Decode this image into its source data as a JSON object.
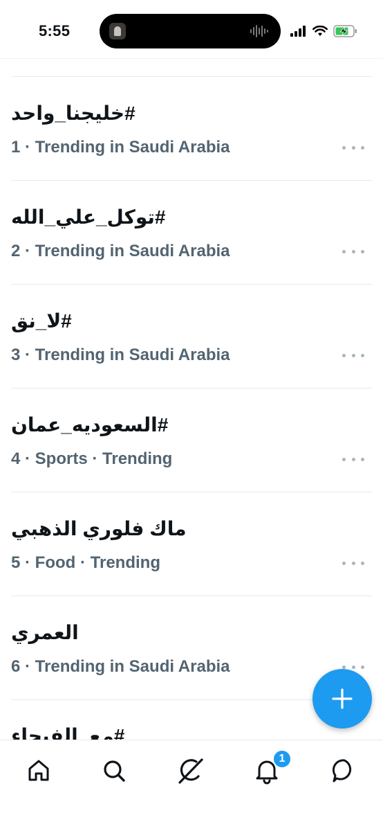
{
  "status_bar": {
    "time": "5:55"
  },
  "trends": [
    {
      "title": "#خليجنا_واحد",
      "meta": "1 · Trending in Saudi Arabia"
    },
    {
      "title": "#توكل_علي_الله",
      "meta": "2 · Trending in Saudi Arabia"
    },
    {
      "title": "#لا_نق",
      "meta": "3 · Trending in Saudi Arabia"
    },
    {
      "title": "#السعوديه_عمان",
      "meta": "4 · Sports · Trending"
    },
    {
      "title": "ماك فلوري الذهبي",
      "meta": "5 · Food · Trending"
    },
    {
      "title": "العمري",
      "meta": "6 · Trending in Saudi Arabia"
    }
  ],
  "partial_trend": {
    "title": "#مع_الفيحاء"
  },
  "nav": {
    "notifications_badge": "1",
    "icons": [
      "home-icon",
      "search-icon",
      "grok-icon",
      "bell-icon",
      "messages-icon"
    ]
  },
  "colors": {
    "accent": "#1d9bf0",
    "text_primary": "#0f1419",
    "text_secondary": "#536471",
    "divider": "#e6e9ea"
  }
}
